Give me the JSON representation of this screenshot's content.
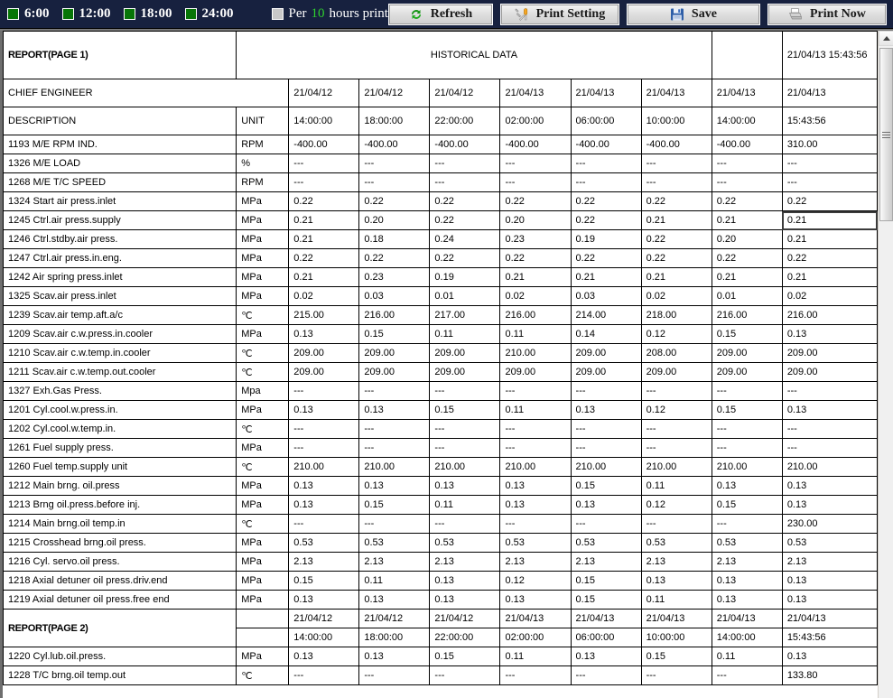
{
  "toolbar": {
    "time_checks": [
      {
        "label": "6:00",
        "checked": true,
        "color": "#077507"
      },
      {
        "label": "12:00",
        "checked": true,
        "color": "#077507"
      },
      {
        "label": "18:00",
        "checked": true,
        "color": "#077507"
      },
      {
        "label": "24:00",
        "checked": true,
        "color": "#077507"
      }
    ],
    "per_checkbox_checked": false,
    "per_prefix": "Per",
    "per_value": "10",
    "per_suffix": "hours print",
    "buttons": [
      {
        "id": "refresh",
        "label": "Refresh",
        "icon": "refresh-icon"
      },
      {
        "id": "print-setting",
        "label": "Print Setting",
        "icon": "wrench-icon"
      },
      {
        "id": "save",
        "label": "Save",
        "icon": "floppy-disk-icon"
      },
      {
        "id": "print-now",
        "label": "Print Now",
        "icon": "printer-icon"
      }
    ]
  },
  "report": {
    "page1_title": "REPORT(PAGE 1)",
    "page2_title": "REPORT(PAGE 2)",
    "historical_label": "HISTORICAL DATA",
    "timestamp": "21/04/13 15:43:56",
    "chief_engineer_label": "CHIEF ENGINEER",
    "description_label": "DESCRIPTION",
    "unit_label": "UNIT",
    "dates": [
      "21/04/12",
      "21/04/12",
      "21/04/12",
      "21/04/13",
      "21/04/13",
      "21/04/13",
      "21/04/13",
      "21/04/13"
    ],
    "times": [
      "14:00:00",
      "18:00:00",
      "22:00:00",
      "02:00:00",
      "06:00:00",
      "10:00:00",
      "14:00:00",
      "15:43:56"
    ],
    "selected_cell": {
      "row": 4,
      "col": 7,
      "value": "0.21"
    },
    "rows": [
      {
        "desc": "1193 M/E RPM IND.",
        "unit": "RPM",
        "values": [
          "-400.00",
          "-400.00",
          "-400.00",
          "-400.00",
          "-400.00",
          "-400.00",
          "-400.00",
          "310.00"
        ]
      },
      {
        "desc": "1326 M/E LOAD",
        "unit": "%",
        "values": [
          "---",
          "---",
          "---",
          "---",
          "---",
          "---",
          "---",
          "---"
        ]
      },
      {
        "desc": "1268 M/E T/C SPEED",
        "unit": "RPM",
        "values": [
          "---",
          "---",
          "---",
          "---",
          "---",
          "---",
          "---",
          "---"
        ]
      },
      {
        "desc": "1324 Start air press.inlet",
        "unit": "MPa",
        "values": [
          "0.22",
          "0.22",
          "0.22",
          "0.22",
          "0.22",
          "0.22",
          "0.22",
          "0.22"
        ]
      },
      {
        "desc": "1245 Ctrl.air press.supply",
        "unit": "MPa",
        "values": [
          "0.21",
          "0.20",
          "0.22",
          "0.20",
          "0.22",
          "0.21",
          "0.21",
          "0.21"
        ]
      },
      {
        "desc": "1246 Ctrl.stdby.air press.",
        "unit": "MPa",
        "values": [
          "0.21",
          "0.18",
          "0.24",
          "0.23",
          "0.19",
          "0.22",
          "0.20",
          "0.21"
        ]
      },
      {
        "desc": "1247 Ctrl.air press.in.eng.",
        "unit": "MPa",
        "values": [
          "0.22",
          "0.22",
          "0.22",
          "0.22",
          "0.22",
          "0.22",
          "0.22",
          "0.22"
        ]
      },
      {
        "desc": "1242 Air spring press.inlet",
        "unit": "MPa",
        "values": [
          "0.21",
          "0.23",
          "0.19",
          "0.21",
          "0.21",
          "0.21",
          "0.21",
          "0.21"
        ]
      },
      {
        "desc": "1325 Scav.air press.inlet",
        "unit": "MPa",
        "values": [
          "0.02",
          "0.03",
          "0.01",
          "0.02",
          "0.03",
          "0.02",
          "0.01",
          "0.02"
        ]
      },
      {
        "desc": "1239 Scav.air temp.aft.a/c",
        "unit": "℃",
        "values": [
          "215.00",
          "216.00",
          "217.00",
          "216.00",
          "214.00",
          "218.00",
          "216.00",
          "216.00"
        ]
      },
      {
        "desc": "1209 Scav.air c.w.press.in.cooler",
        "unit": "MPa",
        "values": [
          "0.13",
          "0.15",
          "0.11",
          "0.11",
          "0.14",
          "0.12",
          "0.15",
          "0.13"
        ]
      },
      {
        "desc": "1210 Scav.air c.w.temp.in.cooler",
        "unit": "℃",
        "values": [
          "209.00",
          "209.00",
          "209.00",
          "210.00",
          "209.00",
          "208.00",
          "209.00",
          "209.00"
        ]
      },
      {
        "desc": "1211 Scav.air c.w.temp.out.cooler",
        "unit": "℃",
        "values": [
          "209.00",
          "209.00",
          "209.00",
          "209.00",
          "209.00",
          "209.00",
          "209.00",
          "209.00"
        ]
      },
      {
        "desc": "1327 Exh.Gas Press.",
        "unit": "Mpa",
        "values": [
          "---",
          "---",
          "---",
          "---",
          "---",
          "---",
          "---",
          "---"
        ]
      },
      {
        "desc": "1201 Cyl.cool.w.press.in.",
        "unit": "MPa",
        "values": [
          "0.13",
          "0.13",
          "0.15",
          "0.11",
          "0.13",
          "0.12",
          "0.15",
          "0.13"
        ]
      },
      {
        "desc": "1202 Cyl.cool.w.temp.in.",
        "unit": "℃",
        "values": [
          "---",
          "---",
          "---",
          "---",
          "---",
          "---",
          "---",
          "---"
        ]
      },
      {
        "desc": "1261 Fuel supply press.",
        "unit": "MPa",
        "values": [
          "---",
          "---",
          "---",
          "---",
          "---",
          "---",
          "---",
          "---"
        ]
      },
      {
        "desc": "1260 Fuel temp.supply unit",
        "unit": "℃",
        "values": [
          "210.00",
          "210.00",
          "210.00",
          "210.00",
          "210.00",
          "210.00",
          "210.00",
          "210.00"
        ]
      },
      {
        "desc": "1212 Main brng. oil.press",
        "unit": "MPa",
        "values": [
          "0.13",
          "0.13",
          "0.13",
          "0.13",
          "0.15",
          "0.11",
          "0.13",
          "0.13"
        ]
      },
      {
        "desc": "1213 Brng oil.press.before inj.",
        "unit": "MPa",
        "values": [
          "0.13",
          "0.15",
          "0.11",
          "0.13",
          "0.13",
          "0.12",
          "0.15",
          "0.13"
        ]
      },
      {
        "desc": "1214 Main brng.oil temp.in",
        "unit": "℃",
        "values": [
          "---",
          "---",
          "---",
          "---",
          "---",
          "---",
          "---",
          "230.00"
        ]
      },
      {
        "desc": "1215 Crosshead brng.oil press.",
        "unit": "MPa",
        "values": [
          "0.53",
          "0.53",
          "0.53",
          "0.53",
          "0.53",
          "0.53",
          "0.53",
          "0.53"
        ]
      },
      {
        "desc": "1216 Cyl. servo.oil press.",
        "unit": "MPa",
        "values": [
          "2.13",
          "2.13",
          "2.13",
          "2.13",
          "2.13",
          "2.13",
          "2.13",
          "2.13"
        ]
      },
      {
        "desc": "1218 Axial detuner oil press.driv.end",
        "unit": "MPa",
        "values": [
          "0.15",
          "0.11",
          "0.13",
          "0.12",
          "0.15",
          "0.13",
          "0.13",
          "0.13"
        ]
      },
      {
        "desc": "1219 Axial detuner oil press.free end",
        "unit": "MPa",
        "values": [
          "0.13",
          "0.13",
          "0.13",
          "0.13",
          "0.15",
          "0.11",
          "0.13",
          "0.13"
        ]
      }
    ],
    "page2_rows": [
      {
        "desc": "1220 Cyl.lub.oil.press.",
        "unit": "MPa",
        "values": [
          "0.13",
          "0.13",
          "0.15",
          "0.11",
          "0.13",
          "0.15",
          "0.11",
          "0.13"
        ]
      },
      {
        "desc": "1228 T/C brng.oil temp.out",
        "unit": "℃",
        "values": [
          "---",
          "---",
          "---",
          "---",
          "---",
          "---",
          "---",
          "133.80"
        ]
      }
    ]
  },
  "scrollbar": {
    "up_arrow": "scroll-up-icon",
    "thumb": "scroll-thumb"
  }
}
